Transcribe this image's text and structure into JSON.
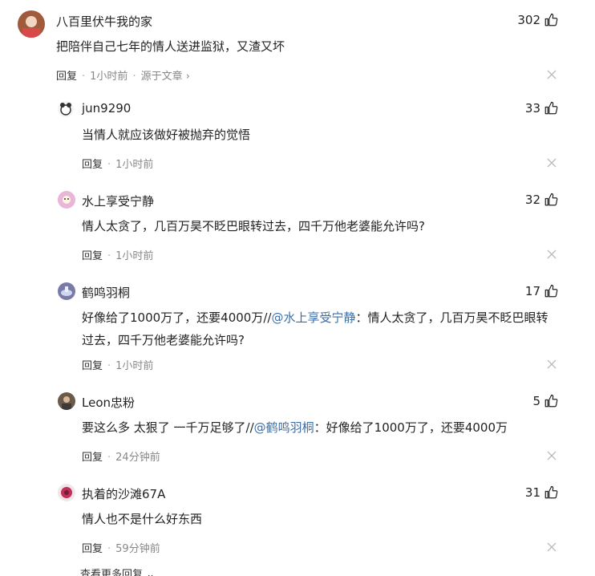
{
  "comments": [
    {
      "user": "八百里伏牛我的家",
      "likes": "302",
      "text": "把陪伴自己七年的情人送进监狱，又渣又坏",
      "reply_label": "回复",
      "time": "1小时前",
      "source": "源于文章",
      "avatar_color": "#a05a3c"
    },
    {
      "user": "jun9290",
      "likes": "33",
      "text": "当情人就应该做好被抛弃的觉悟",
      "reply_label": "回复",
      "time": "1小时前",
      "avatar_color": "#333333"
    },
    {
      "user": "水上享受宁静",
      "likes": "32",
      "text": "情人太贪了，几百万昊不眨巴眼转过去，四千万他老婆能允许吗?",
      "reply_label": "回复",
      "time": "1小时前",
      "avatar_color": "#e9b5d8"
    },
    {
      "user": "鹤鸣羽桐",
      "likes": "17",
      "text_before": "好像给了1000万了，还要4000万//",
      "mention": "@水上享受宁静",
      "text_after": "：情人太贪了，几百万昊不眨巴眼转过去，四千万他老婆能允许吗?",
      "reply_label": "回复",
      "time": "1小时前",
      "avatar_color": "#7a7aa8"
    },
    {
      "user": "Leon忠粉",
      "likes": "5",
      "text_before": "要这么多 太狠了 一千万足够了//",
      "mention": "@鹤鸣羽桐",
      "text_after": "：好像给了1000万了，还要4000万",
      "reply_label": "回复",
      "time": "24分钟前",
      "avatar_color": "#6b5a4a"
    },
    {
      "user": "执着的沙滩67A",
      "likes": "31",
      "text": "情人也不是什么好东西",
      "reply_label": "回复",
      "time": "59分钟前",
      "avatar_color": "#c0305a"
    }
  ],
  "more_replies": "查看更多回复"
}
